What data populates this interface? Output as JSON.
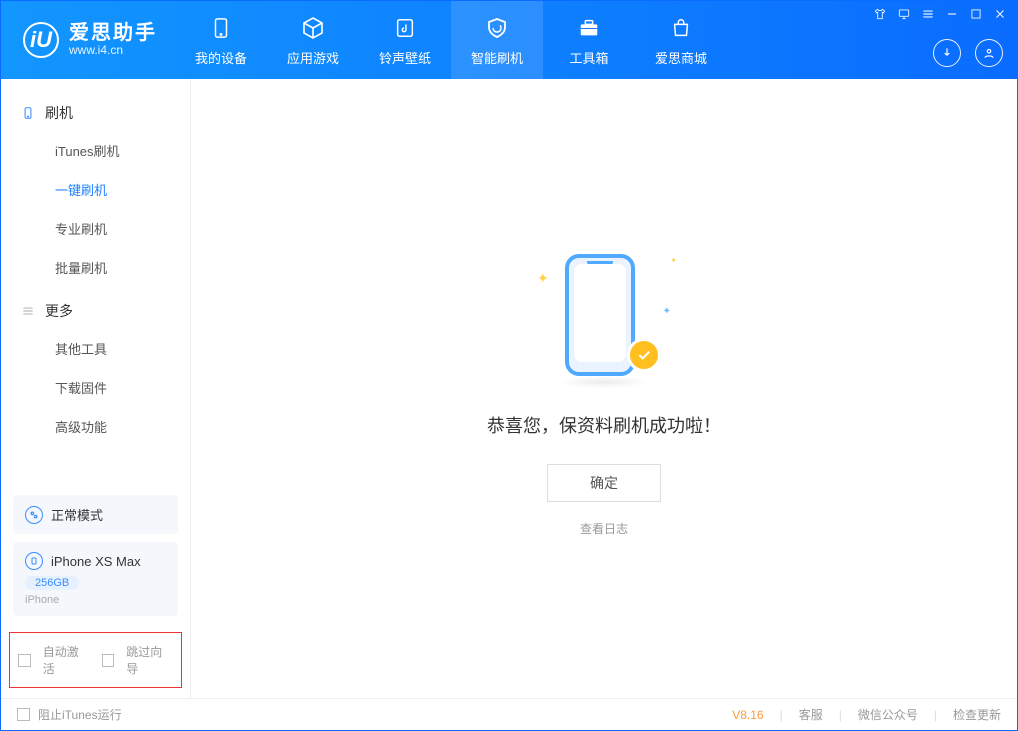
{
  "app": {
    "title": "爱思助手",
    "subtitle": "www.i4.cn"
  },
  "nav": [
    {
      "label": "我的设备"
    },
    {
      "label": "应用游戏"
    },
    {
      "label": "铃声壁纸"
    },
    {
      "label": "智能刷机"
    },
    {
      "label": "工具箱"
    },
    {
      "label": "爱思商城"
    }
  ],
  "sidebar": {
    "section1": {
      "title": "刷机",
      "items": [
        "iTunes刷机",
        "一键刷机",
        "专业刷机",
        "批量刷机"
      ]
    },
    "section2": {
      "title": "更多",
      "items": [
        "其他工具",
        "下载固件",
        "高级功能"
      ]
    }
  },
  "mode_card": {
    "label": "正常模式"
  },
  "device_card": {
    "name": "iPhone XS Max",
    "storage": "256GB",
    "type": "iPhone"
  },
  "checks": {
    "auto_activate": "自动激活",
    "skip_wizard": "跳过向导"
  },
  "main": {
    "message": "恭喜您，保资料刷机成功啦！",
    "ok": "确定",
    "log_link": "查看日志"
  },
  "status": {
    "block_itunes": "阻止iTunes运行",
    "version": "V8.16",
    "support": "客服",
    "wechat": "微信公众号",
    "update": "检查更新"
  }
}
